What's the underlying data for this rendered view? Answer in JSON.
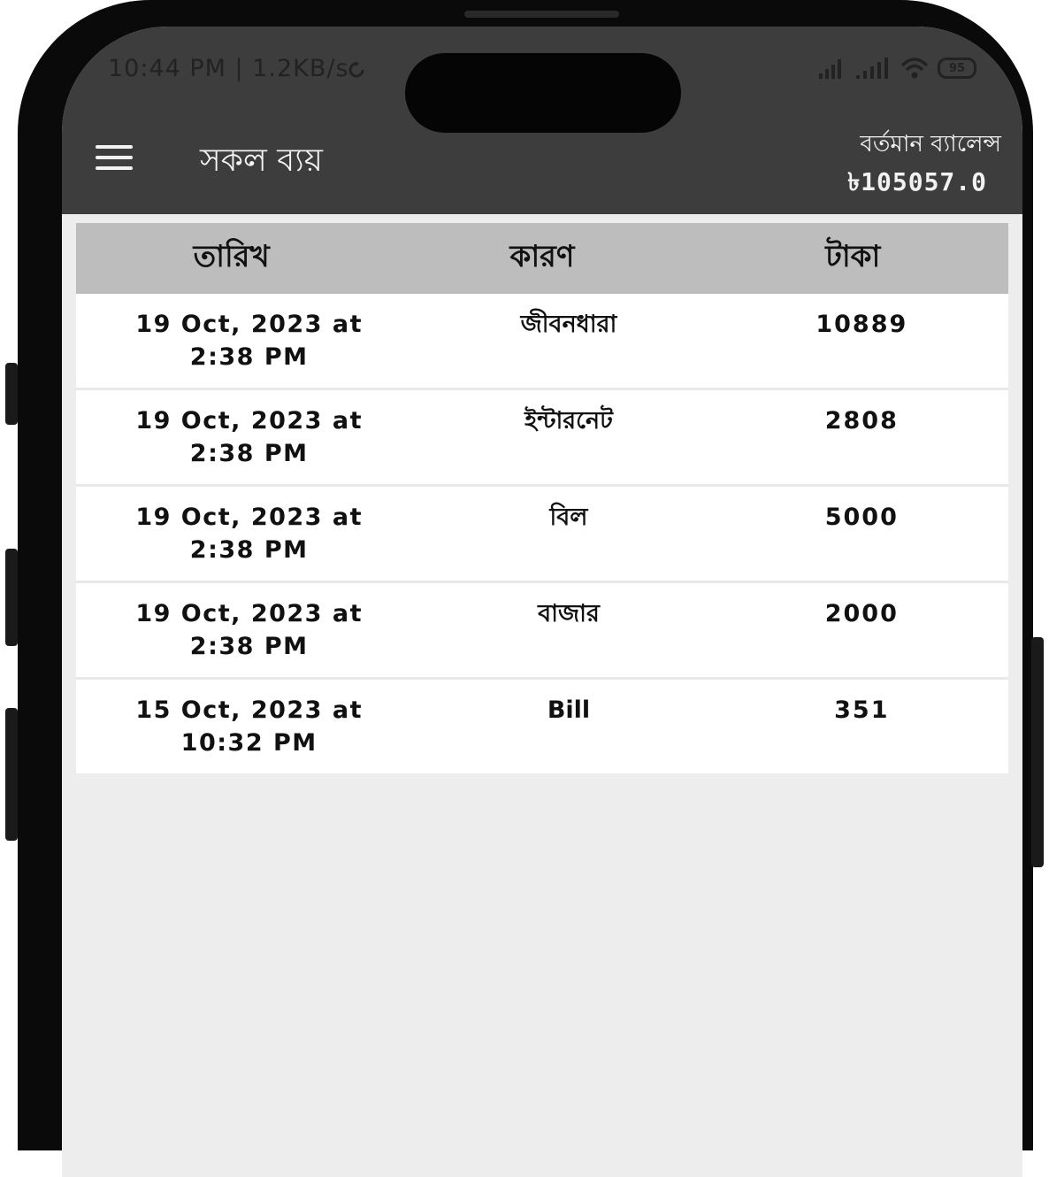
{
  "status_bar": {
    "time_text": "10:44 PM | 1.2KB/s",
    "battery_level": "95",
    "icons": [
      "sync-icon",
      "signal-icon",
      "signal-icon",
      "wifi-icon",
      "battery-icon"
    ]
  },
  "app_bar": {
    "title": "সকল ব্যয়",
    "menu_icon": "menu-icon",
    "balance_label": "বর্তমান ব্যালেন্স",
    "balance_value": "৳105057.0"
  },
  "table": {
    "headers": [
      "তারিখ",
      "কারণ",
      "টাকা"
    ],
    "rows": [
      {
        "date": "19 Oct, 2023 at 2:38 PM",
        "reason": "জীবনধারা",
        "amount": "10889"
      },
      {
        "date": "19 Oct, 2023 at 2:38 PM",
        "reason": "ইন্টারনেট",
        "amount": "2808"
      },
      {
        "date": "19 Oct, 2023 at 2:38 PM",
        "reason": "বিল",
        "amount": "5000"
      },
      {
        "date": "19 Oct, 2023 at 2:38 PM",
        "reason": "বাজার",
        "amount": "2000"
      },
      {
        "date": "15 Oct, 2023 at 10:32 PM",
        "reason": "Bill",
        "amount": "351"
      }
    ]
  },
  "colors": {
    "app_bar": "#3d3d3d",
    "table_header": "#bdbdbd",
    "background": "#ededed"
  }
}
